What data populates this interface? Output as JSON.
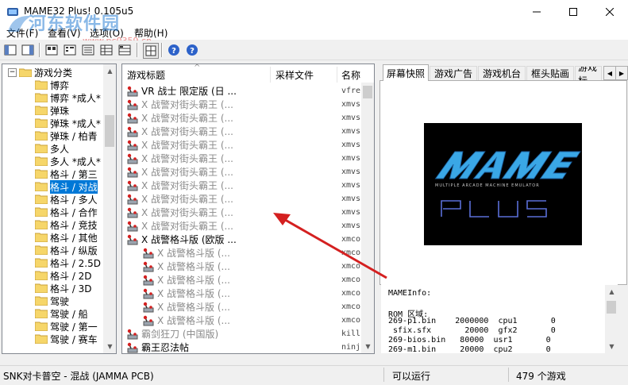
{
  "window": {
    "title": "MAME32 Plus! 0.105u5",
    "watermark_text": "河东软件园",
    "watermark_url": "www.pc0359.cn"
  },
  "menu": [
    "文件(F)",
    "查看(V)",
    "选项(O)",
    "帮助(H)"
  ],
  "toolbar_icons": [
    "folder-list-icon",
    "detail-view-icon",
    "large-icons-icon",
    "small-icons-icon",
    "list-view-icon",
    "details-icon",
    "grouped-view-icon",
    "fullscreen-icon",
    "help-icon",
    "about-icon"
  ],
  "tree": {
    "root": "游戏分类",
    "items": [
      "博弈",
      "博弈 *成人*",
      "弹珠",
      "弹珠 *成人*",
      "弹珠 / 柏青",
      "多人",
      "多人 *成人*",
      "格斗 / 第三",
      "格斗 / 对战",
      "格斗 / 多人",
      "格斗 / 合作",
      "格斗 / 竞技",
      "格斗 / 其他",
      "格斗 / 纵版",
      "格斗 / 2.5D",
      "格斗 / 2D",
      "格斗 / 3D",
      "驾驶",
      "驾驶 / 船",
      "驾驶 / 第一",
      "驾驶 / 赛车"
    ],
    "selected_index": 8
  },
  "list": {
    "columns": [
      "游戏标题",
      "采样文件",
      "名称"
    ],
    "rows": [
      {
        "title": "VR 战士 限定版 (日 ...",
        "file": "vfre",
        "type": "parent"
      },
      {
        "title": "X 战警对街头霸王 (...",
        "file": "xmvs",
        "type": "clone"
      },
      {
        "title": "X 战警对街头霸王 (...",
        "file": "xmvs",
        "type": "clone"
      },
      {
        "title": "X 战警对街头霸王 (...",
        "file": "xmvs",
        "type": "clone"
      },
      {
        "title": "X 战警对街头霸王 (...",
        "file": "xmvs",
        "type": "clone"
      },
      {
        "title": "X 战警对街头霸王 (...",
        "file": "xmvs",
        "type": "clone"
      },
      {
        "title": "X 战警对街头霸王 (...",
        "file": "xmvs",
        "type": "clone"
      },
      {
        "title": "X 战警对街头霸王 (...",
        "file": "xmvs",
        "type": "clone"
      },
      {
        "title": "X 战警对街头霸王 (...",
        "file": "xmvs",
        "type": "clone"
      },
      {
        "title": "X 战警对街头霸王 (...",
        "file": "xmvs",
        "type": "clone"
      },
      {
        "title": "X 战警对街头霸王 (...",
        "file": "xmvs",
        "type": "clone"
      },
      {
        "title": "X 战警格斗版 (欧版 ...",
        "file": "xmco",
        "type": "parent"
      },
      {
        "title": "X 战警格斗版 (...",
        "file": "xmco",
        "type": "clone2"
      },
      {
        "title": "X 战警格斗版 (...",
        "file": "xmco",
        "type": "clone2"
      },
      {
        "title": "X 战警格斗版 (...",
        "file": "xmco",
        "type": "clone2"
      },
      {
        "title": "X 战警格斗版 (...",
        "file": "xmco",
        "type": "clone2"
      },
      {
        "title": "X 战警格斗版 (...",
        "file": "xmco",
        "type": "clone2"
      },
      {
        "title": "X 战警格斗版 (...",
        "file": "xmco",
        "type": "clone2"
      },
      {
        "title": "霸剑狂刀 (中国版)",
        "file": "kill",
        "type": "clone"
      },
      {
        "title": "霸王忍法帖",
        "file": "ninj",
        "type": "parent"
      }
    ]
  },
  "tabs": [
    "屏幕快照",
    "游戏广告",
    "游戏机台",
    "框头贴画",
    "游戏标"
  ],
  "info": {
    "header": "MAMEInfo:",
    "rom_label": "ROM 区域:",
    "rom_lines": [
      "269-p1.bin    2000000  cpu1       0",
      " sfix.sfx       20000  gfx2       0",
      "269-bios.bin   80000  usr1       0",
      "269-m1.bin     20000  cpu2       0"
    ]
  },
  "status": {
    "game": "SNK对卡普空 - 混战 (JAMMA PCB)",
    "state": "可以运行",
    "count": "479 个游戏"
  },
  "colors": {
    "selection": "#0078d7",
    "arrow": "#d42020",
    "mame_blue": "#3aa7e6"
  }
}
